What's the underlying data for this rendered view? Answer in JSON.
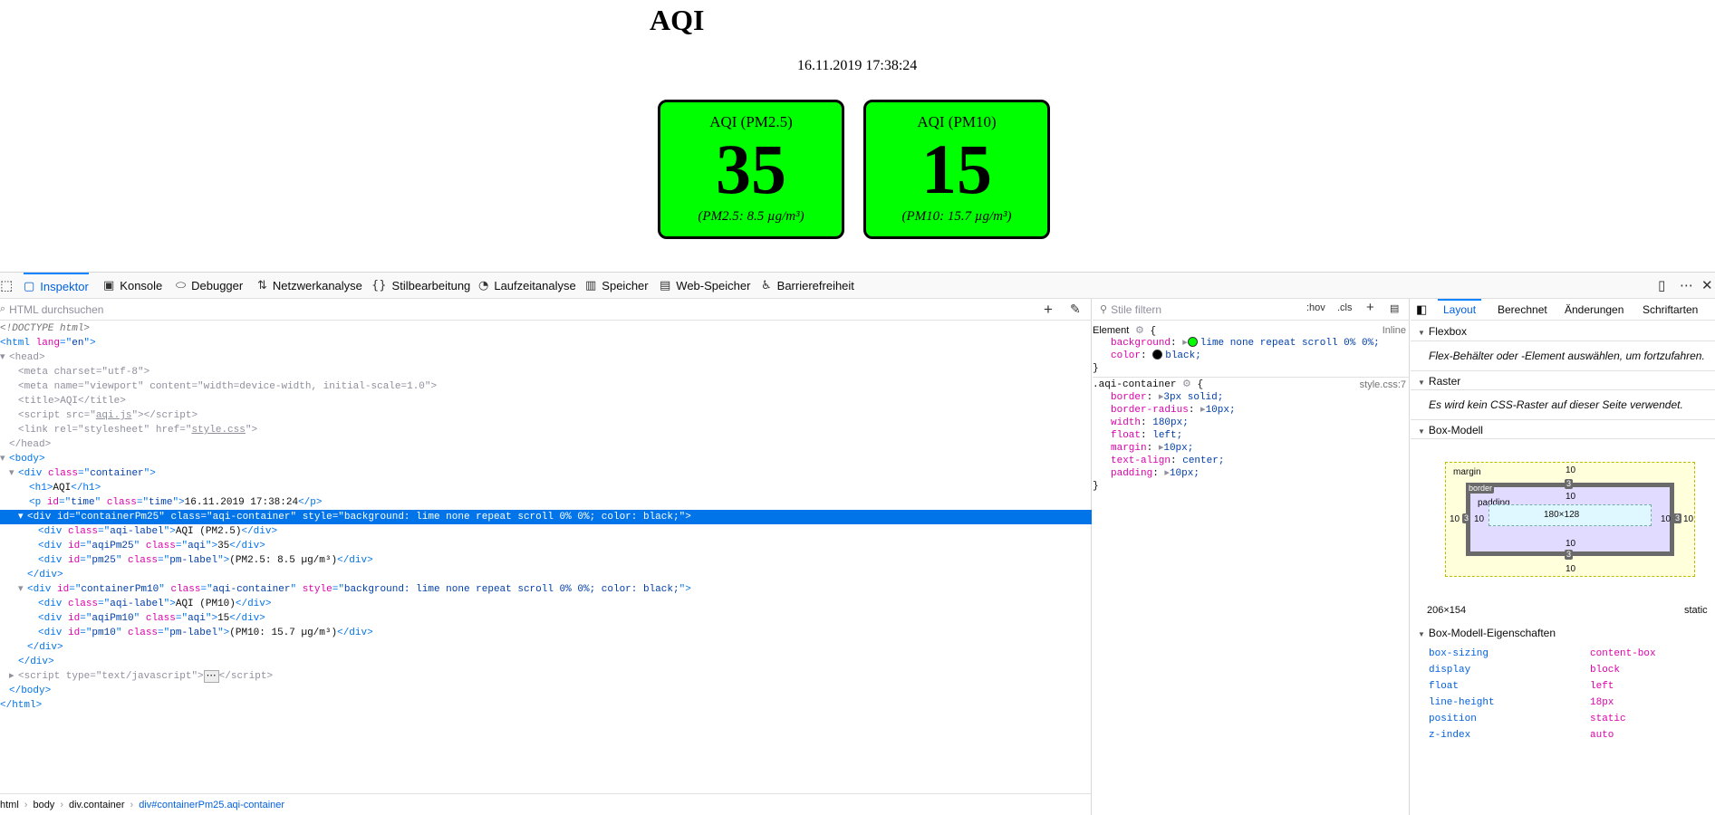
{
  "preview": {
    "heading": "AQI",
    "time": "16.11.2019 17:38:24",
    "cards": [
      {
        "label": "AQI (PM2.5)",
        "value": "35",
        "pm": "(PM2.5: 8.5 µg/m³)",
        "color": "#00ff00"
      },
      {
        "label": "AQI (PM10)",
        "value": "15",
        "pm": "(PM10: 15.7 µg/m³)",
        "color": "#00ff00"
      }
    ]
  },
  "devtools": {
    "tabs": [
      {
        "label": "Inspektor",
        "icon": "inspector-icon"
      },
      {
        "label": "Konsole",
        "icon": "console-icon"
      },
      {
        "label": "Debugger",
        "icon": "debugger-icon"
      },
      {
        "label": "Netzwerkanalyse",
        "icon": "network-icon"
      },
      {
        "label": "Stilbearbeitung",
        "icon": "style-editor-icon"
      },
      {
        "label": "Laufzeitanalyse",
        "icon": "performance-icon"
      },
      {
        "label": "Speicher",
        "icon": "memory-icon"
      },
      {
        "label": "Web-Speicher",
        "icon": "storage-icon"
      },
      {
        "label": "Barrierefreiheit",
        "icon": "accessibility-icon"
      }
    ],
    "markup": {
      "search_placeholder": "HTML durchsuchen",
      "tree": {
        "doctype": "<!DOCTYPE html>",
        "html_lang": "en",
        "meta_charset": "utf-8",
        "meta_vp_name": "viewport",
        "meta_vp_content": "width=device-width, initial-scale=1.0",
        "title": "AQI",
        "script_src": "aqi.js",
        "link_rel": "stylesheet",
        "link_href": "style.css",
        "container_class": "container",
        "h1_text": "AQI",
        "p_id": "time",
        "p_class": "time",
        "p_text": "16.11.2019 17:38:24",
        "c1_id": "containerPm25",
        "c_class": "aqi-container",
        "c_style": "background: lime none repeat scroll 0% 0%; color: black;",
        "label_class": "aqi-label",
        "c1_label": "AQI (PM2.5)",
        "c1_aqi_id": "aqiPm25",
        "aqi_class": "aqi",
        "c1_aqi": "35",
        "c1_pm_id": "pm25",
        "pm_class": "pm-label",
        "c1_pm": "(PM2.5: 8.5 µg/m³)",
        "c2_id": "containerPm10",
        "c2_label": "AQI (PM10)",
        "c2_aqi_id": "aqiPm10",
        "c2_aqi": "15",
        "c2_pm_id": "pm10",
        "c2_pm": "(PM10: 15.7 µg/m³)",
        "script_type": "text/javascript"
      },
      "breadcrumbs": [
        "html",
        "body",
        "div.container",
        "div#containerPm25.aqi-container"
      ]
    },
    "rules": {
      "filter_placeholder": "Stile filtern",
      "hov": ":hov",
      "cls": ".cls",
      "element_selector": "Element",
      "element_source": "Inline",
      "element_props": [
        {
          "name": "background",
          "value": "lime none repeat scroll 0% 0%;",
          "swatch": "#00ff00"
        },
        {
          "name": "color",
          "value": "black;",
          "swatch": "#000000"
        }
      ],
      "aqi_selector": ".aqi-container",
      "aqi_source": "style.css:7",
      "aqi_props": [
        {
          "name": "border",
          "value": "3px solid;"
        },
        {
          "name": "border-radius",
          "value": "10px;"
        },
        {
          "name": "width",
          "value": "180px;"
        },
        {
          "name": "float",
          "value": "left;"
        },
        {
          "name": "margin",
          "value": "10px;"
        },
        {
          "name": "text-align",
          "value": "center;"
        },
        {
          "name": "padding",
          "value": "10px;"
        }
      ]
    },
    "layout": {
      "tabs": [
        "Layout",
        "Berechnet",
        "Änderungen",
        "Schriftarten"
      ],
      "flexbox_title": "Flexbox",
      "flexbox_msg": "Flex-Behälter oder -Element auswählen, um fortzufahren.",
      "grid_title": "Raster",
      "grid_msg": "Es wird kein CSS-Raster auf dieser Seite verwendet.",
      "boxmodel_title": "Box-Modell",
      "boxmodel": {
        "margin_label": "margin",
        "border_label": "border",
        "padding_label": "padding",
        "margin": "10",
        "border": "3",
        "padding": "10",
        "content": "180×128"
      },
      "size": "206×154",
      "position": "static",
      "props_title": "Box-Modell-Eigenschaften",
      "props": [
        {
          "name": "box-sizing",
          "value": "content-box"
        },
        {
          "name": "display",
          "value": "block"
        },
        {
          "name": "float",
          "value": "left"
        },
        {
          "name": "line-height",
          "value": "18px"
        },
        {
          "name": "position",
          "value": "static"
        },
        {
          "name": "z-index",
          "value": "auto"
        }
      ]
    }
  }
}
